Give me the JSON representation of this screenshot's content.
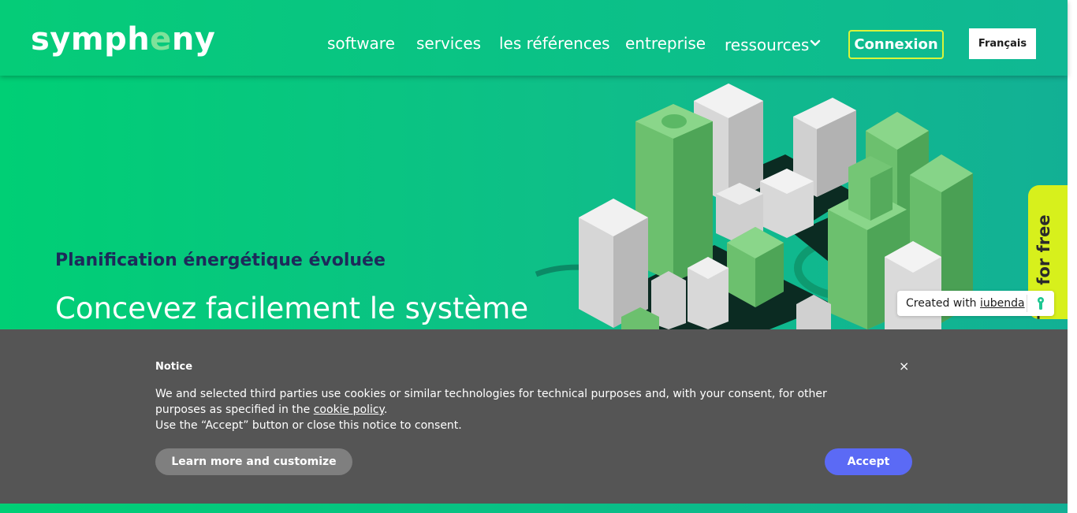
{
  "header": {
    "logo_prefix": "symph",
    "logo_accent": "e",
    "logo_suffix": "ny",
    "nav": {
      "software": "software",
      "services": "services",
      "references": "les références",
      "entreprise": "entreprise",
      "ressources": "ressources"
    },
    "login_label": "Connexion",
    "language_label": "Français"
  },
  "hero": {
    "subtitle": "Planification énergétique évoluée",
    "title": "Concevez facilement le système"
  },
  "try_free": {
    "label": "Try for free"
  },
  "iubenda_badge": {
    "text": "Created with ",
    "link": "iubenda"
  },
  "cookie_banner": {
    "title": "Notice",
    "close": "×",
    "text_part1": "We and selected third parties use cookies or similar technologies for technical purposes and, with your consent, for other purposes as specified in the ",
    "policy_link": "cookie policy",
    "text_part2": ".",
    "text_line2": "Use the “Accept” button or close this notice to consent.",
    "learn_more": "Learn more and customize",
    "accept": "Accept"
  },
  "icons": {
    "chevron": "chevron-down-icon",
    "close": "close-icon",
    "iubenda_logo": "iubenda-logo-icon",
    "city_illustration": "city-illustration"
  },
  "colors": {
    "brand_green": "#00cf75",
    "teal": "#12b095",
    "navy": "#1d2a5a",
    "lime": "#d7f01c",
    "accept_blue": "#5b6af5",
    "banner_gray": "#555555"
  }
}
